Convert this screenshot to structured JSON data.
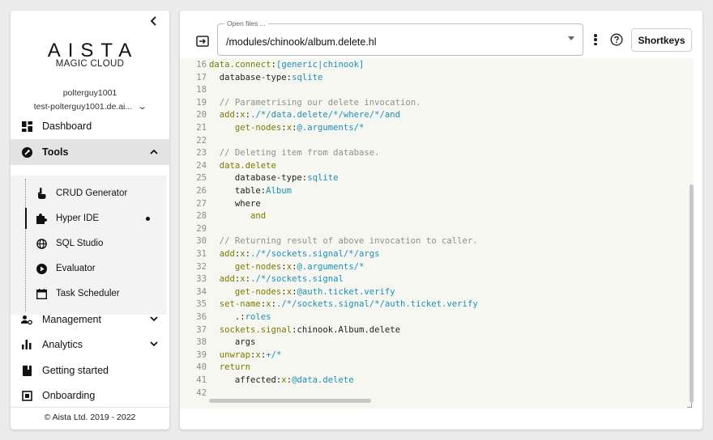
{
  "sidebar": {
    "logo": "AISTA",
    "logo_sub": "MAGIC CLOUD",
    "username": "polterguy1001",
    "backend": "test-polterguy1001.de.ai...",
    "nav": {
      "dashboard": "Dashboard",
      "tools": "Tools",
      "management": "Management",
      "analytics": "Analytics",
      "getting_started": "Getting started",
      "onboarding": "Onboarding"
    },
    "tools": {
      "crud": "CRUD Generator",
      "hyper_ide": "Hyper IDE",
      "sql_studio": "SQL Studio",
      "evaluator": "Evaluator",
      "task_scheduler": "Task Scheduler"
    },
    "footer": "© Aista Ltd. 2019 - 2022"
  },
  "editor_header": {
    "open_files_label": "Open files ...",
    "current_file": "/modules/chinook/album.delete.hl",
    "shortkeys_label": "Shortkeys"
  },
  "code": [
    {
      "n": "16",
      "parts": [
        [
          "k",
          "data.connect"
        ],
        [
          "p",
          ":"
        ],
        [
          "s",
          "[generic|chinook]"
        ]
      ]
    },
    {
      "n": "17",
      "parts": [
        [
          "p",
          "  database-type:"
        ],
        [
          "s",
          "sqlite"
        ]
      ]
    },
    {
      "n": "18",
      "parts": []
    },
    {
      "n": "19",
      "parts": [
        [
          "c",
          "  // Parametrising our delete invocation."
        ]
      ]
    },
    {
      "n": "20",
      "parts": [
        [
          "k",
          "  add"
        ],
        [
          "p",
          ":"
        ],
        [
          "k",
          "x"
        ],
        [
          "p",
          ":"
        ],
        [
          "s",
          "./*/data.delete/*/where/*/and"
        ]
      ]
    },
    {
      "n": "21",
      "parts": [
        [
          "k",
          "     get-nodes"
        ],
        [
          "p",
          ":"
        ],
        [
          "k",
          "x"
        ],
        [
          "p",
          ":"
        ],
        [
          "s",
          "@.arguments/*"
        ]
      ]
    },
    {
      "n": "22",
      "parts": []
    },
    {
      "n": "23",
      "parts": [
        [
          "c",
          "  // Deleting item from database."
        ]
      ]
    },
    {
      "n": "24",
      "parts": [
        [
          "k",
          "  data.delete"
        ]
      ]
    },
    {
      "n": "25",
      "parts": [
        [
          "p",
          "     database-type:"
        ],
        [
          "s",
          "sqlite"
        ]
      ]
    },
    {
      "n": "26",
      "parts": [
        [
          "p",
          "     table:"
        ],
        [
          "s",
          "Album"
        ]
      ]
    },
    {
      "n": "27",
      "parts": [
        [
          "p",
          "     where"
        ]
      ]
    },
    {
      "n": "28",
      "parts": [
        [
          "k",
          "        and"
        ]
      ]
    },
    {
      "n": "29",
      "parts": []
    },
    {
      "n": "30",
      "parts": [
        [
          "c",
          "  // Returning result of above invocation to caller."
        ]
      ]
    },
    {
      "n": "31",
      "parts": [
        [
          "k",
          "  add"
        ],
        [
          "p",
          ":"
        ],
        [
          "k",
          "x"
        ],
        [
          "p",
          ":"
        ],
        [
          "s",
          "./*/sockets.signal/*/args"
        ]
      ]
    },
    {
      "n": "32",
      "parts": [
        [
          "k",
          "     get-nodes"
        ],
        [
          "p",
          ":"
        ],
        [
          "k",
          "x"
        ],
        [
          "p",
          ":"
        ],
        [
          "s",
          "@.arguments/*"
        ]
      ]
    },
    {
      "n": "33",
      "parts": [
        [
          "k",
          "  add"
        ],
        [
          "p",
          ":"
        ],
        [
          "k",
          "x"
        ],
        [
          "p",
          ":"
        ],
        [
          "s",
          "./*/sockets.signal"
        ]
      ]
    },
    {
      "n": "34",
      "parts": [
        [
          "k",
          "     get-nodes"
        ],
        [
          "p",
          ":"
        ],
        [
          "k",
          "x"
        ],
        [
          "p",
          ":"
        ],
        [
          "s",
          "@auth.ticket.verify"
        ]
      ]
    },
    {
      "n": "35",
      "parts": [
        [
          "k",
          "  set-name"
        ],
        [
          "p",
          ":"
        ],
        [
          "k",
          "x"
        ],
        [
          "p",
          ":"
        ],
        [
          "s",
          "./*/sockets.signal/*/auth.ticket.verify"
        ]
      ]
    },
    {
      "n": "36",
      "parts": [
        [
          "p",
          "     .:"
        ],
        [
          "s",
          "roles"
        ]
      ]
    },
    {
      "n": "37",
      "parts": [
        [
          "k",
          "  sockets.signal"
        ],
        [
          "p",
          ":chinook.Album.delete"
        ]
      ]
    },
    {
      "n": "38",
      "parts": [
        [
          "p",
          "     args"
        ]
      ]
    },
    {
      "n": "39",
      "parts": [
        [
          "k",
          "  unwrap"
        ],
        [
          "p",
          ":"
        ],
        [
          "k",
          "x"
        ],
        [
          "p",
          ":"
        ],
        [
          "s",
          "+/*"
        ]
      ]
    },
    {
      "n": "40",
      "parts": [
        [
          "k",
          "  return"
        ]
      ]
    },
    {
      "n": "41",
      "parts": [
        [
          "p",
          "     affected:"
        ],
        [
          "k",
          "x"
        ],
        [
          "p",
          ":"
        ],
        [
          "s",
          "@data.delete"
        ]
      ]
    },
    {
      "n": "42",
      "parts": []
    }
  ],
  "colors": {
    "keyword": "#7a7a00",
    "string": "#1a8fb8",
    "comment": "#8f8f8f",
    "editor_bg": "#f7f7f1"
  }
}
